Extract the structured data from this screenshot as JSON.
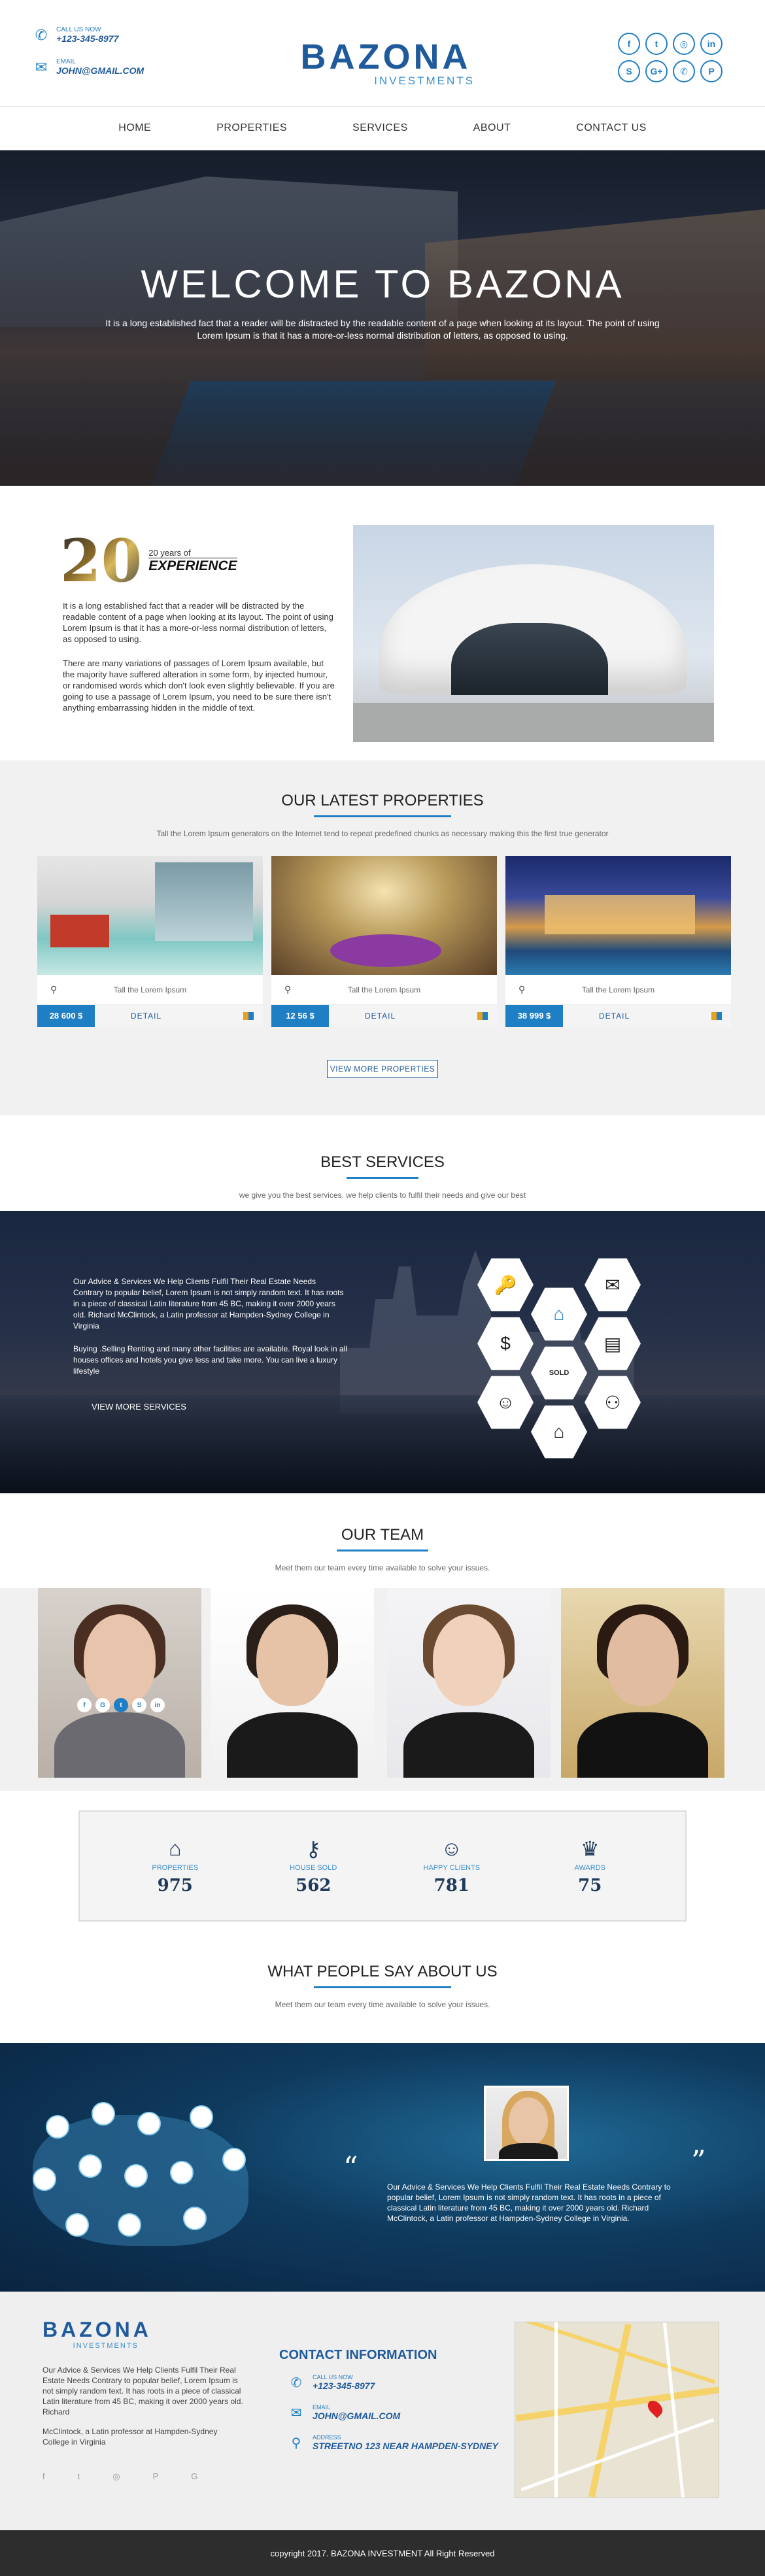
{
  "header": {
    "call_label": "CALL US NOW",
    "phone": "+123-345-8977",
    "email_label": "EMAIL",
    "email": "JOHN@GMAIL.COM",
    "logo_name": "BAZONA",
    "logo_sub": "INVESTMENTS",
    "socials": [
      {
        "icon": "facebook-icon",
        "glyph": "f"
      },
      {
        "icon": "twitter-icon",
        "glyph": "t"
      },
      {
        "icon": "instagram-icon",
        "glyph": "◎"
      },
      {
        "icon": "linkedin-icon",
        "glyph": "in"
      },
      {
        "icon": "skype-icon",
        "glyph": "S"
      },
      {
        "icon": "google-plus-icon",
        "glyph": "G+"
      },
      {
        "icon": "phone-icon",
        "glyph": "✆"
      },
      {
        "icon": "pinterest-icon",
        "glyph": "P"
      }
    ]
  },
  "nav": {
    "items": [
      "HOME",
      "PROPERTIES",
      "SERVICES",
      "ABOUT",
      "CONTACT US"
    ]
  },
  "hero": {
    "title": "WELCOME TO BAZONA",
    "text": "It is a long established fact that a reader will be distracted by the readable content of a page when looking at its layout. The point of using Lorem Ipsum is that it has a more-or-less normal distribution of letters, as opposed to using."
  },
  "experience": {
    "number": "20",
    "small": "20 years of",
    "big": "EXPERIENCE",
    "para1": "It is a long established fact that a reader will be distracted by the readable content of a page when looking at its layout. The point of using Lorem Ipsum is that it has a more-or-less normal distribution of letters, as opposed to using.",
    "para2": "There are many variations of passages of Lorem Ipsum available, but the majority have suffered alteration in some form, by injected humour, or randomised words which don't look even slightly believable. If you are going to use a passage of Lorem Ipsum, you need to be sure there isn't anything embarrassing hidden in the middle of text."
  },
  "properties": {
    "title": "OUR LATEST PROPERTIES",
    "subtitle": "Tall the Lorem Ipsum generators on the Internet tend to repeat predefined chunks as necessary making this the first true generator",
    "cards": [
      {
        "location": "Tall the Lorem Ipsum",
        "price": "28 600 $",
        "detail": "DETAIL"
      },
      {
        "location": "Tall the Lorem Ipsum",
        "price": "12 56 $",
        "detail": "DETAIL"
      },
      {
        "location": "Tall the Lorem Ipsum",
        "price": "38 999 $",
        "detail": "DETAIL"
      }
    ],
    "more_label": "VIEW MORE PROPERTIES"
  },
  "services": {
    "title": "BEST SERVICES",
    "subtitle": "we give you the best services. we help clients to fulfil their needs and give our best",
    "para1": "Our Advice & Services We Help Clients Fulfil Their Real Estate Needs Contrary to popular belief, Lorem Ipsum is not simply random text. It has roots in a piece of classical Latin literature from 45 BC, making it over 2000 years old. Richard McClintock, a Latin professor at Hampden-Sydney College in Virginia",
    "para2": "Buying .Selling Renting and many other facilities are available. Royal look in all houses offices and hotels you give less and take more. You can live a luxury lifestyle",
    "button": "VIEW MORE SERVICES",
    "icons": [
      {
        "name": "keys-icon",
        "glyph": "🔑"
      },
      {
        "name": "house-icon",
        "glyph": "⌂"
      },
      {
        "name": "mail-icon",
        "glyph": "✉"
      },
      {
        "name": "money-bag-icon",
        "glyph": "$"
      },
      {
        "name": "sold-sign-icon",
        "glyph": "SOLD"
      },
      {
        "name": "document-icon",
        "glyph": "▤"
      },
      {
        "name": "support-icon",
        "glyph": "☺"
      },
      {
        "name": "users-icon",
        "glyph": "⚇"
      },
      {
        "name": "home-icon",
        "glyph": "⌂"
      }
    ]
  },
  "team": {
    "title": "OUR TEAM",
    "subtitle": "Meet them our team every time available to solve your issues."
  },
  "stats": [
    {
      "icon": "house-icon",
      "glyph": "⌂",
      "label": "PROPERTIES",
      "value": "975"
    },
    {
      "icon": "key-icon",
      "glyph": "⚷",
      "label": "HOUSE SOLD",
      "value": "562"
    },
    {
      "icon": "smiley-icon",
      "glyph": "☺",
      "label": "HAPPY CLIENTS",
      "value": "781"
    },
    {
      "icon": "trophy-icon",
      "glyph": "♛",
      "label": "AWARDS",
      "value": "75"
    }
  ],
  "testimonials": {
    "title": "WHAT PEOPLE SAY ABOUT US",
    "subtitle": "Meet them our team every time available to solve your issues.",
    "quote": "Our Advice & Services We Help Clients Fulfil Their Real Estate Needs Contrary to popular belief, Lorem Ipsum is not simply random text. It has roots in a piece of classical Latin literature from 45 BC, making it over 2000 years old. Richard McClintock, a Latin professor at Hampden-Sydney College in Virginia."
  },
  "footer": {
    "logo_name": "BAZONA",
    "logo_sub": "INVESTMENTS",
    "about1": "Our Advice & Services We Help Clients Fulfil Their Real Estate Needs Contrary to popular belief, Lorem Ipsum is not simply random text. It has roots in a piece of classical Latin literature from 45 BC, making it over 2000 years old. Richard",
    "about2": "McClintock, a Latin professor at Hampden-Sydney College in Virginia",
    "socials": [
      "f",
      "t",
      "◎",
      "P",
      "G"
    ],
    "contact_title": "CONTACT INFORMATION",
    "call_label": "CALL US NOW",
    "phone": "+123-345-8977",
    "email_label": "EMAIL",
    "email": "JOHN@GMAIL.COM",
    "address_label": "ADDRESS",
    "address": "STREETNO 123 NEAR HAMPDEN-SYDNEY",
    "copyright": "copyright 2017. BAZONA INVESTMENT All Right Reserved"
  },
  "colors": {
    "brand": "#1f5a9a",
    "accent": "#1f7fc4"
  }
}
